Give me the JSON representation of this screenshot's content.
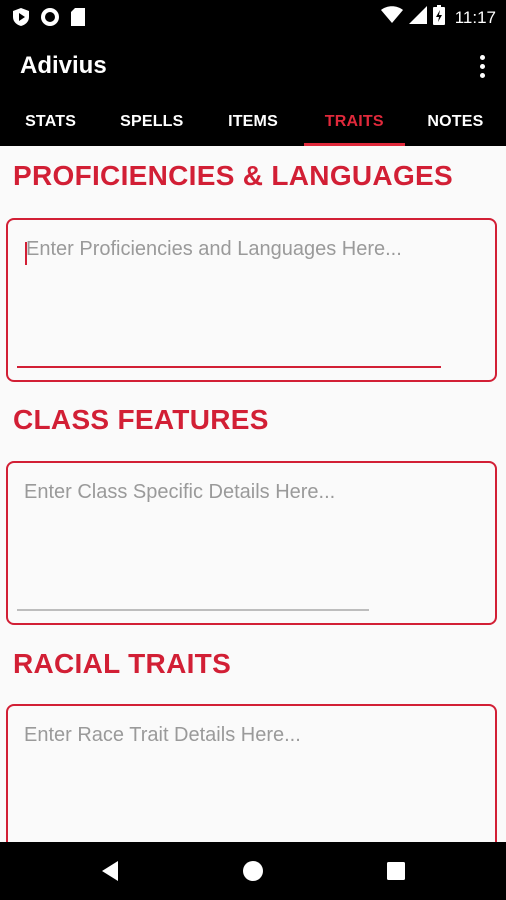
{
  "status_bar": {
    "time": "11:17",
    "icons": [
      "play-protect-icon",
      "record-icon",
      "sd-card-icon",
      "wifi-icon",
      "signal-icon",
      "battery-icon"
    ]
  },
  "app": {
    "title": "Adivius"
  },
  "tabs": [
    {
      "label": "STATS",
      "active": false
    },
    {
      "label": "SPELLS",
      "active": false
    },
    {
      "label": "ITEMS",
      "active": false
    },
    {
      "label": "TRAITS",
      "active": true
    },
    {
      "label": "NOTES",
      "active": false
    }
  ],
  "sections": [
    {
      "title": "PROFICIENCIES & LANGUAGES",
      "placeholder": "Enter Proficiencies and Languages Here...",
      "focused": true
    },
    {
      "title": "CLASS FEATURES",
      "placeholder": "Enter Class Specific Details Here...",
      "focused": false
    },
    {
      "title": "RACIAL TRAITS",
      "placeholder": "Enter Race Trait Details Here...",
      "focused": false
    }
  ],
  "colors": {
    "accent": "#d21f35",
    "tab_active": "#e0293b",
    "bar_background": "#000000",
    "page_background": "#fafafa",
    "placeholder": "#9a9a9a"
  },
  "nav_bar": {
    "icons": [
      "back-icon",
      "home-icon",
      "recents-icon"
    ]
  }
}
